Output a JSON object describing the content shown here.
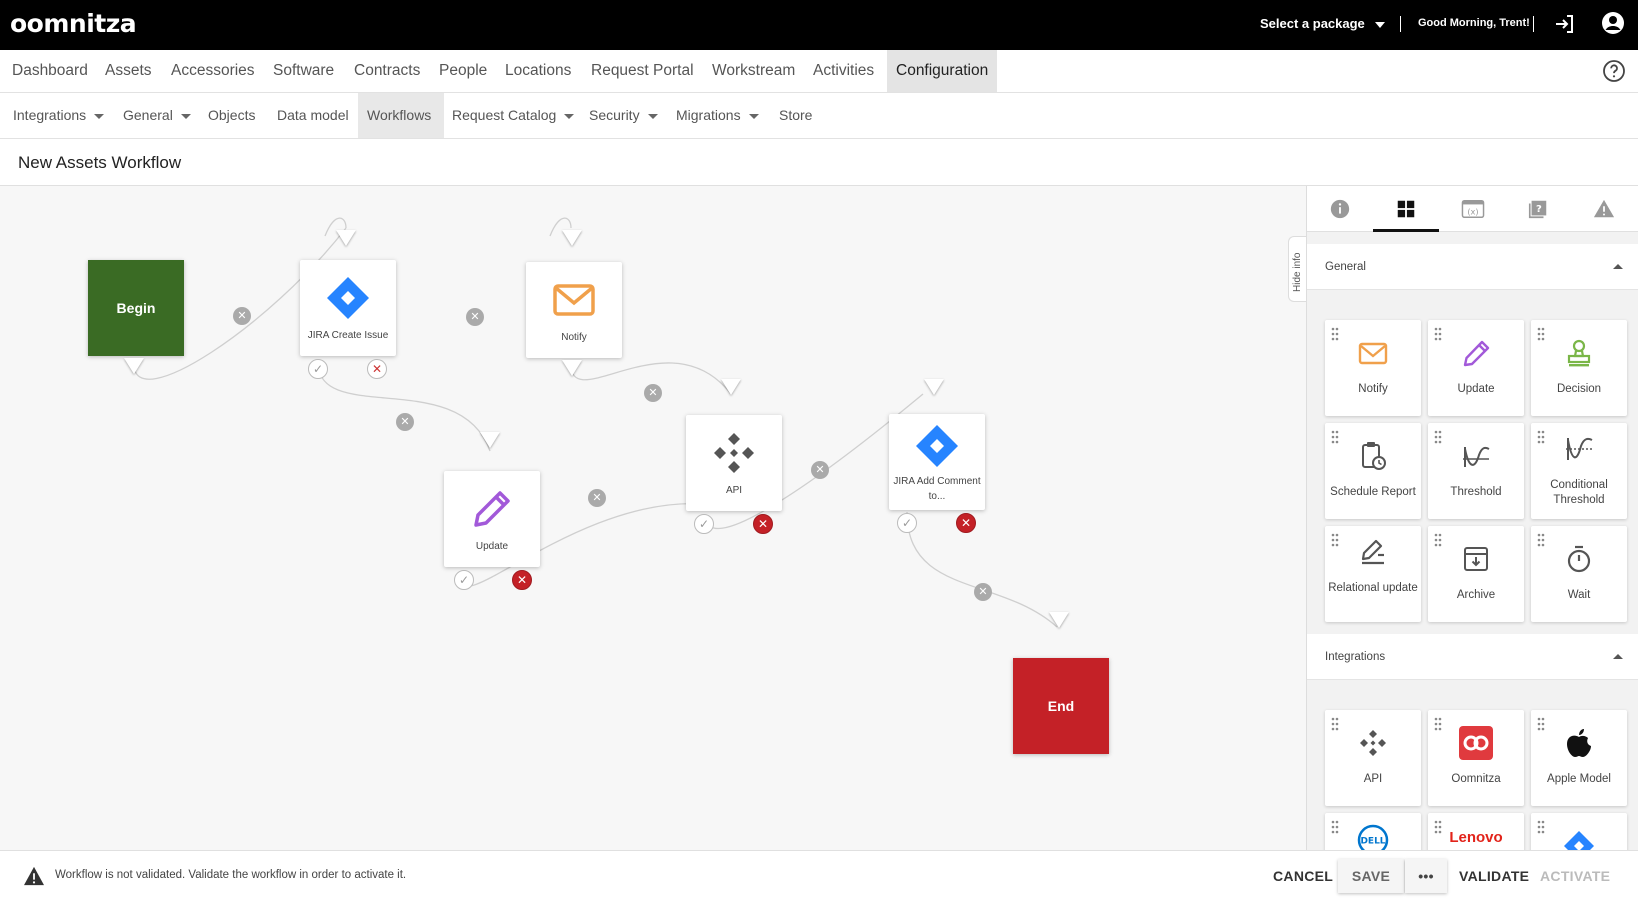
{
  "header": {
    "logo": "oomnitza",
    "package_label": "Select a package",
    "greeting": "Good Morning, Trent!"
  },
  "main_nav": [
    {
      "label": "Dashboard"
    },
    {
      "label": "Assets"
    },
    {
      "label": "Accessories"
    },
    {
      "label": "Software"
    },
    {
      "label": "Contracts"
    },
    {
      "label": "People"
    },
    {
      "label": "Locations"
    },
    {
      "label": "Request Portal"
    },
    {
      "label": "Workstream"
    },
    {
      "label": "Activities"
    },
    {
      "label": "Configuration",
      "active": true
    }
  ],
  "sub_nav": [
    {
      "label": "Integrations",
      "dropdown": true
    },
    {
      "label": "General",
      "dropdown": true
    },
    {
      "label": "Objects"
    },
    {
      "label": "Data model"
    },
    {
      "label": "Workflows",
      "active": true
    },
    {
      "label": "Request Catalog",
      "dropdown": true
    },
    {
      "label": "Security",
      "dropdown": true
    },
    {
      "label": "Migrations",
      "dropdown": true
    },
    {
      "label": "Store"
    }
  ],
  "page": {
    "title": "New Assets Workflow"
  },
  "workflow": {
    "begin_label": "Begin",
    "end_label": "End",
    "nodes": [
      {
        "label": "JIRA Create Issue",
        "icon": "jira-icon"
      },
      {
        "label": "Notify",
        "icon": "mail-icon"
      },
      {
        "label": "Update",
        "icon": "pencil-icon"
      },
      {
        "label": "API",
        "icon": "api-icon"
      },
      {
        "label": "JIRA Add Comment to...",
        "icon": "jira-icon"
      }
    ]
  },
  "panel": {
    "tabs": [
      "info-icon",
      "blocks-grid-icon",
      "variable-icon",
      "help-book-icon",
      "warning-icon"
    ],
    "hide_info_label": "Hide info",
    "general_title": "General",
    "general_blocks": [
      {
        "label": "Notify",
        "icon": "mail-icon"
      },
      {
        "label": "Update",
        "icon": "pencil-icon"
      },
      {
        "label": "Decision",
        "icon": "stamp-icon"
      },
      {
        "label": "Schedule Report",
        "icon": "schedule-report-icon"
      },
      {
        "label": "Threshold",
        "icon": "threshold-icon"
      },
      {
        "label": "Conditional Threshold",
        "icon": "conditional-threshold-icon"
      },
      {
        "label": "Relational update",
        "icon": "relational-update-icon"
      },
      {
        "label": "Archive",
        "icon": "archive-icon"
      },
      {
        "label": "Wait",
        "icon": "timer-icon"
      }
    ],
    "integrations_title": "Integrations",
    "integration_blocks": [
      {
        "label": "API",
        "icon": "api-icon"
      },
      {
        "label": "Oomnitza",
        "icon": "oomnitza-icon"
      },
      {
        "label": "Apple Model",
        "icon": "apple-icon"
      },
      {
        "label": "",
        "icon": "dell-icon",
        "logo_text": "DELL"
      },
      {
        "label": "",
        "icon": "lenovo-icon",
        "logo_text": "Lenovo"
      },
      {
        "label": "",
        "icon": "jira-icon"
      }
    ]
  },
  "footer": {
    "warning_text": "Workflow is not validated. Validate the workflow in order to activate it.",
    "cancel_label": "CANCEL",
    "save_label": "SAVE",
    "more_label": "•••",
    "validate_label": "VALIDATE",
    "activate_label": "ACTIVATE"
  },
  "colors": {
    "begin": "#3a6b24",
    "end": "#c42127",
    "jira_blue": "#2684ff",
    "notify_orange": "#f0a04b",
    "update_purple": "#a259d9",
    "decision_green": "#7ab648",
    "oomnitza_red": "#e03a3e",
    "lenovo_red": "#e2231a",
    "dell_blue": "#0076ce"
  }
}
